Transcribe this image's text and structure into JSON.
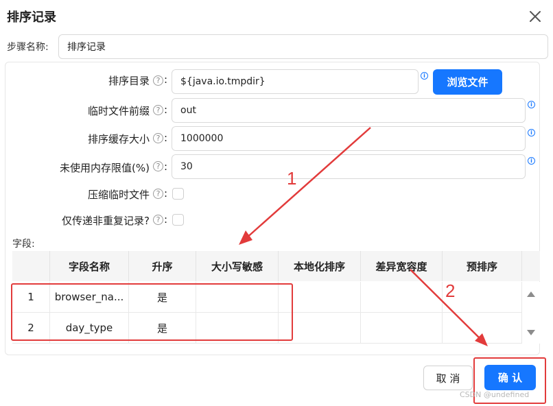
{
  "dialog": {
    "title": "排序记录"
  },
  "step_name": {
    "label": "步骤名称:",
    "value": "排序记录"
  },
  "form": {
    "sort_dir": {
      "label": "排序目录",
      "value": "${java.io.tmpdir}",
      "browse": "浏览文件"
    },
    "temp_prefix": {
      "label": "临时文件前缀",
      "value": "out"
    },
    "sort_buffer": {
      "label": "排序缓存大小",
      "value": "1000000"
    },
    "mem_limit": {
      "label": "未使用内存限值(%)",
      "value": "30"
    },
    "compress_temp": {
      "label": "压缩临时文件"
    },
    "unique_only": {
      "label": "仅传递非重复记录?"
    },
    "help_glyph": "?",
    "info_glyph": "i",
    "colon": ":"
  },
  "fields": {
    "label": "字段:",
    "columns": [
      "字段名称",
      "升序",
      "大小写敏感",
      "本地化排序",
      "差异宽容度",
      "预排序"
    ],
    "rows": [
      {
        "num": "1",
        "name": "browser_na...",
        "asc": "是"
      },
      {
        "num": "2",
        "name": "day_type",
        "asc": "是"
      }
    ]
  },
  "buttons": {
    "cancel": "取 消",
    "ok": "确 认"
  },
  "annotations": {
    "one": "1",
    "two": "2",
    "color": "#e23b3b"
  },
  "watermark": "CSDN @undefined",
  "colors": {
    "primary": "#1677ff",
    "header_bg": "#f5f5f5"
  }
}
